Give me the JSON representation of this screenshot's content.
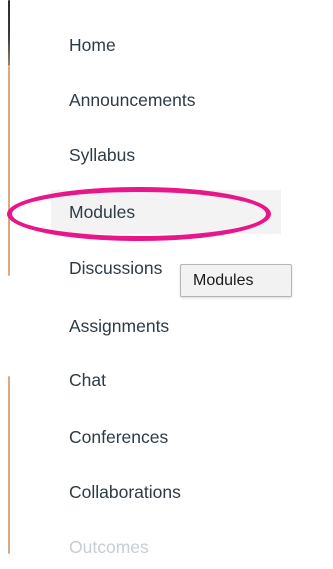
{
  "nav": {
    "items": [
      {
        "label": "Home",
        "state": "normal"
      },
      {
        "label": "Announcements",
        "state": "normal"
      },
      {
        "label": "Syllabus",
        "state": "normal"
      },
      {
        "label": "Modules",
        "state": "hover"
      },
      {
        "label": "Discussions",
        "state": "normal"
      },
      {
        "label": "Assignments",
        "state": "normal"
      },
      {
        "label": "Chat",
        "state": "normal"
      },
      {
        "label": "Conferences",
        "state": "normal"
      },
      {
        "label": "Collaborations",
        "state": "normal"
      },
      {
        "label": "Outcomes",
        "state": "faded"
      }
    ]
  },
  "tooltip": {
    "text": "Modules"
  },
  "colors": {
    "text": "#2d3b45",
    "hover_background": "#f3f3f3",
    "highlight": "#e8168a",
    "accent_bar": "#dba981"
  }
}
